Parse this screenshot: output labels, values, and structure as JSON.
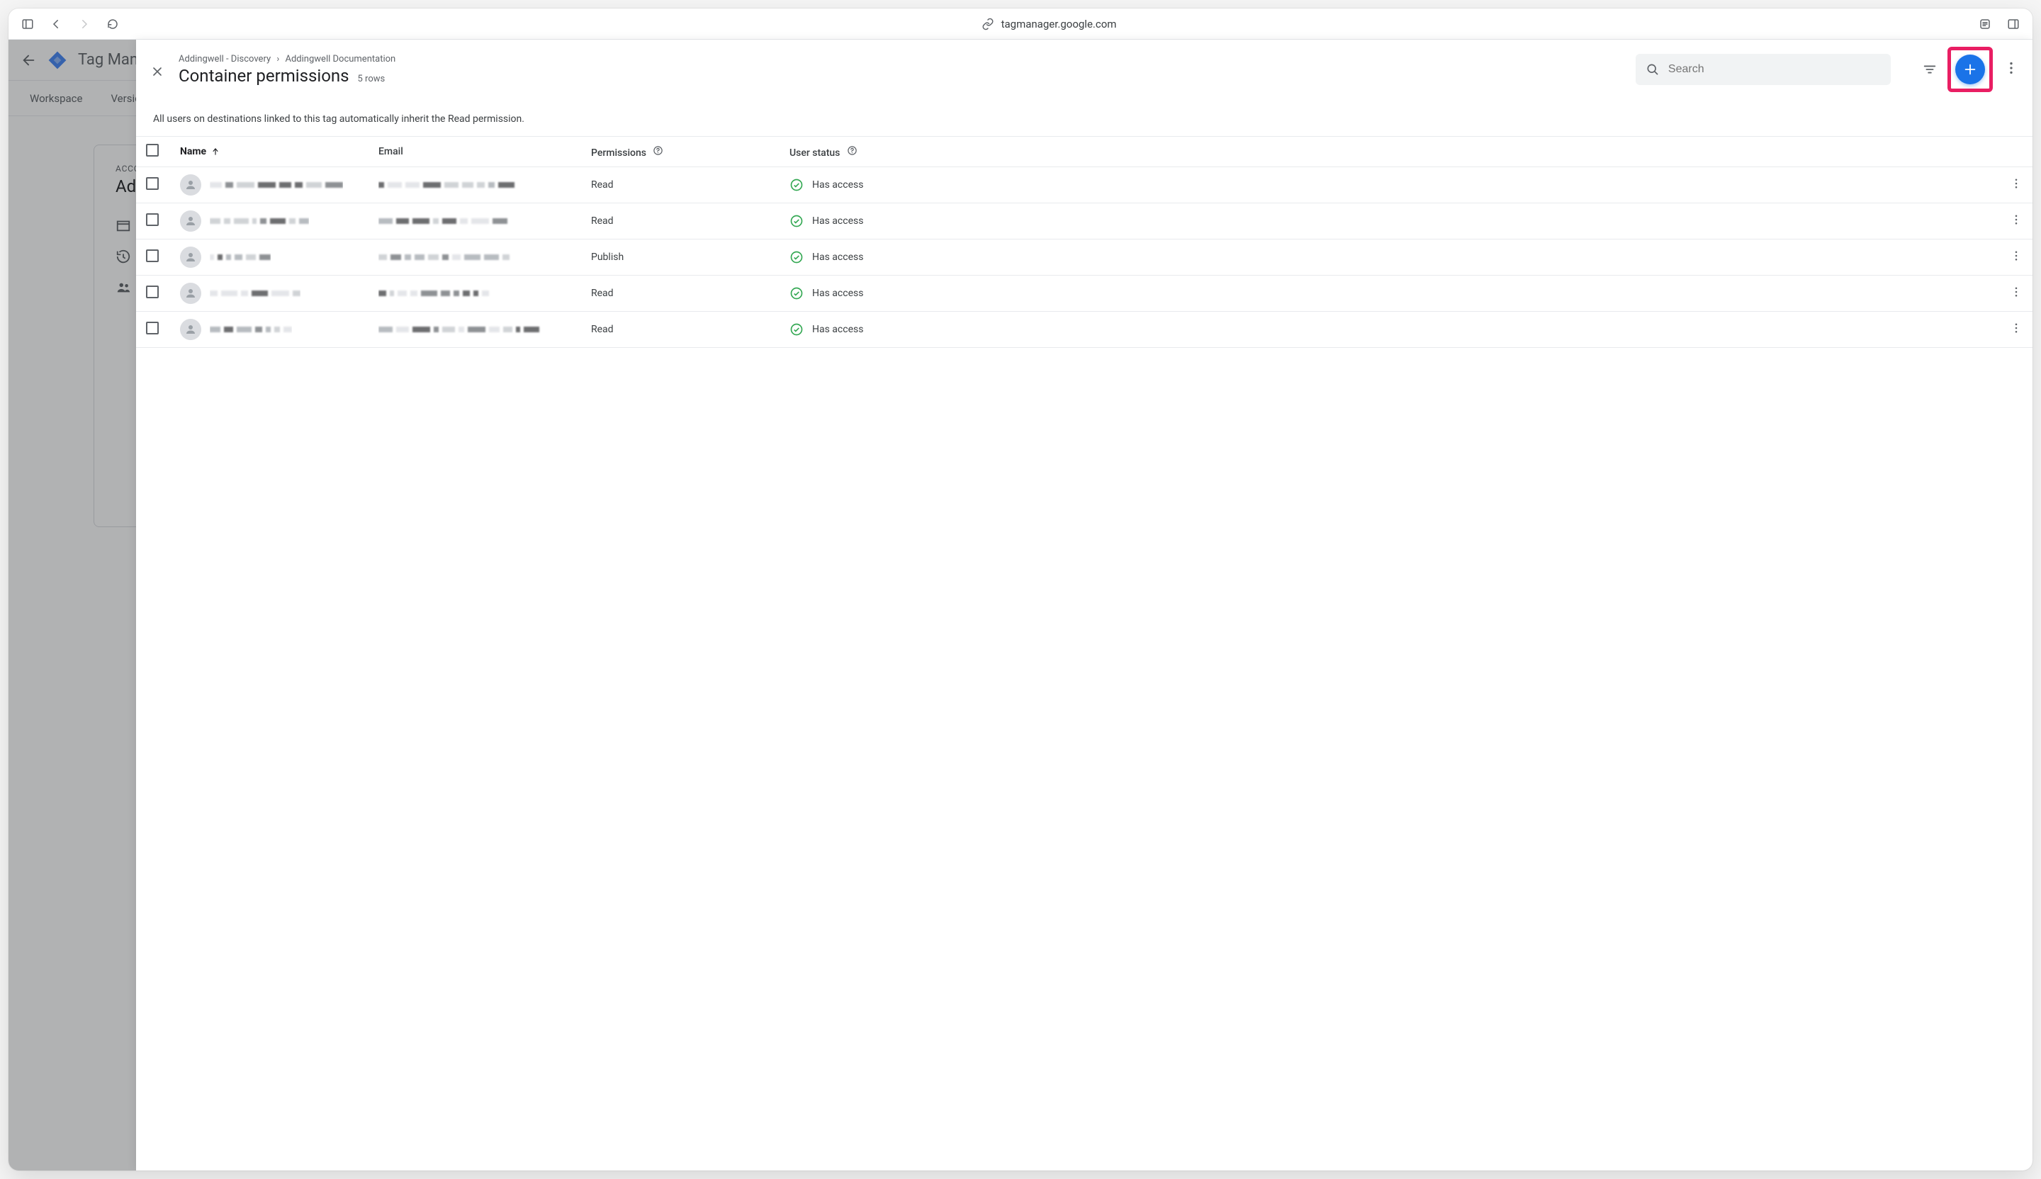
{
  "browser": {
    "url_host": "tagmanager.google.com"
  },
  "background": {
    "app_name": "Tag Manager",
    "tabs": [
      "Workspace",
      "Versions"
    ],
    "card_eyebrow": "ACCOUNT",
    "card_title": "Addingwell"
  },
  "panel": {
    "breadcrumb_a": "Addingwell - Discovery",
    "breadcrumb_b": "Addingwell Documentation",
    "title": "Container permissions",
    "row_count_label": "5 rows",
    "search_placeholder": "Search",
    "info_text": "All users on destinations linked to this tag automatically inherit the Read permission.",
    "columns": {
      "name": "Name",
      "email": "Email",
      "permissions": "Permissions",
      "user_status": "User status"
    },
    "rows": [
      {
        "permission": "Read",
        "status": "Has access"
      },
      {
        "permission": "Read",
        "status": "Has access"
      },
      {
        "permission": "Publish",
        "status": "Has access"
      },
      {
        "permission": "Read",
        "status": "Has access"
      },
      {
        "permission": "Read",
        "status": "Has access"
      }
    ]
  }
}
